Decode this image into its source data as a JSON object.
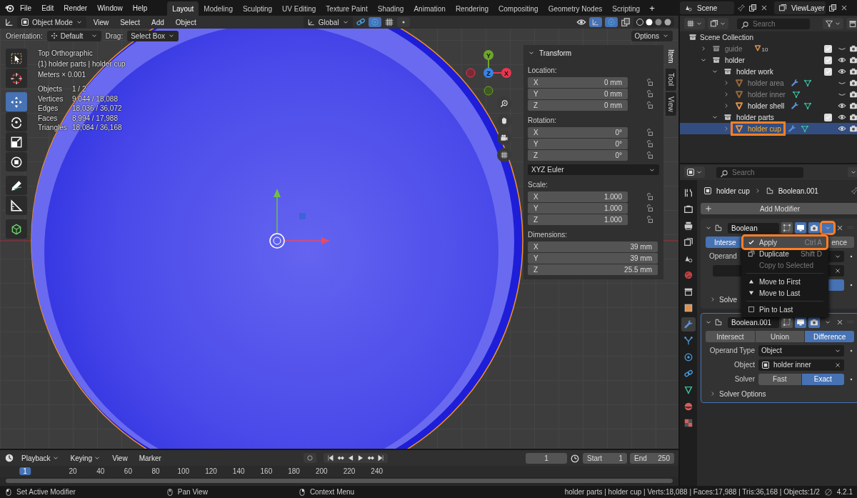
{
  "topbar": {
    "menus": [
      "File",
      "Edit",
      "Render",
      "Window",
      "Help"
    ],
    "workspaces": [
      {
        "label": "Layout",
        "selected": true
      },
      {
        "label": "Modeling",
        "selected": false
      },
      {
        "label": "Sculpting",
        "selected": false
      },
      {
        "label": "UV Editing",
        "selected": false
      },
      {
        "label": "Texture Paint",
        "selected": false
      },
      {
        "label": "Shading",
        "selected": false
      },
      {
        "label": "Animation",
        "selected": false
      },
      {
        "label": "Rendering",
        "selected": false
      },
      {
        "label": "Compositing",
        "selected": false
      },
      {
        "label": "Geometry Nodes",
        "selected": false
      },
      {
        "label": "Scripting",
        "selected": false
      }
    ],
    "add_workspace": "+",
    "scene": "Scene",
    "view_layer": "ViewLayer"
  },
  "viewport_header": {
    "mode": "Object Mode",
    "menus": [
      "View",
      "Select",
      "Add",
      "Object"
    ],
    "orientation": "Global"
  },
  "tool_settings": {
    "orientation_label": "Orientation:",
    "orientation": "Default",
    "drag_label": "Drag:",
    "drag": "Select Box",
    "options": "Options"
  },
  "viewport": {
    "tool_groups": [
      {
        "tools": [
          {
            "kind": "select",
            "selected": false
          },
          {
            "kind": "cursor",
            "selected": false
          }
        ]
      },
      {
        "tools": [
          {
            "kind": "move",
            "selected": true
          },
          {
            "kind": "rotate",
            "selected": false
          },
          {
            "kind": "scale",
            "selected": false
          },
          {
            "kind": "transform",
            "selected": false
          }
        ]
      },
      {
        "tools": [
          {
            "kind": "annotate",
            "selected": false
          },
          {
            "kind": "measure",
            "selected": false
          }
        ]
      },
      {
        "tools": [
          {
            "kind": "add_cube",
            "selected": false
          }
        ]
      }
    ],
    "overlay_lines": [
      "Top Orthographic",
      "(1) holder parts | holder cup",
      "Meters × 0.001"
    ],
    "stats": [
      {
        "label": "Objects",
        "value": "1 / 2"
      },
      {
        "label": "Vertices",
        "value": "9,044 / 18,088"
      },
      {
        "label": "Edges",
        "value": "18,036 / 36,072"
      },
      {
        "label": "Faces",
        "value": "8,994 / 17,988"
      },
      {
        "label": "Triangles",
        "value": "18,084 / 36,168"
      }
    ],
    "axes": [
      {
        "label": "Y",
        "color": "#6ea52c"
      },
      {
        "label": "Z",
        "color": "#3b83e0"
      },
      {
        "label": "X",
        "color": "#e5384f"
      }
    ]
  },
  "sidebar": {
    "title": "Transform",
    "groups": [
      {
        "label": "Location:",
        "lock": true,
        "rows": [
          {
            "axis": "X",
            "value": "0 mm"
          },
          {
            "axis": "Y",
            "value": "0 mm"
          },
          {
            "axis": "Z",
            "value": "0 mm"
          }
        ]
      },
      {
        "label": "Rotation:",
        "lock": true,
        "mode": "XYZ Euler",
        "rows": [
          {
            "axis": "X",
            "value": "0°"
          },
          {
            "axis": "Y",
            "value": "0°"
          },
          {
            "axis": "Z",
            "value": "0°"
          }
        ]
      },
      {
        "label": "Scale:",
        "lock": true,
        "rows": [
          {
            "axis": "X",
            "value": "1.000"
          },
          {
            "axis": "Y",
            "value": "1.000"
          },
          {
            "axis": "Z",
            "value": "1.000"
          }
        ]
      },
      {
        "label": "Dimensions:",
        "lock": false,
        "rows": [
          {
            "axis": "X",
            "value": "39 mm"
          },
          {
            "axis": "Y",
            "value": "39 mm"
          },
          {
            "axis": "Z",
            "value": "25.5 mm"
          }
        ]
      }
    ],
    "tabs": [
      {
        "label": "Item",
        "selected": true
      },
      {
        "label": "Tool",
        "selected": false
      },
      {
        "label": "View",
        "selected": false
      }
    ]
  },
  "outliner": {
    "search_placeholder": "Search",
    "root": "Scene Collection",
    "items": [
      {
        "name": "guide",
        "kind": "collection",
        "expanded": false,
        "checked": true,
        "visible": false,
        "selected": false,
        "highlighted": false,
        "badge": "10"
      },
      {
        "name": "holder",
        "kind": "collection",
        "expanded": true,
        "checked": true,
        "visible": true,
        "selected": false,
        "highlighted": false,
        "children": [
          {
            "name": "holder work",
            "kind": "collection",
            "expanded": true,
            "checked": true,
            "visible": true,
            "selected": false,
            "highlighted": false,
            "children": [
              {
                "name": "holder area",
                "kind": "object",
                "expanded": false,
                "visible": false,
                "modifiers": true,
                "selected": false,
                "highlighted": false
              },
              {
                "name": "holder inner",
                "kind": "object",
                "expanded": false,
                "visible": false,
                "modifiers": false,
                "selected": false,
                "highlighted": false
              },
              {
                "name": "holder shell",
                "kind": "object",
                "expanded": false,
                "visible": true,
                "modifiers": true,
                "selected": false,
                "highlighted": false
              }
            ]
          },
          {
            "name": "holder parts",
            "kind": "collection",
            "expanded": true,
            "checked": true,
            "visible": true,
            "selected": false,
            "highlighted": false,
            "children": [
              {
                "name": "holder cup",
                "kind": "object",
                "expanded": false,
                "visible": true,
                "modifiers": true,
                "selected": true,
                "highlighted": true
              }
            ]
          }
        ]
      }
    ]
  },
  "properties": {
    "search_placeholder": "Search",
    "tabs": [
      {
        "kind": "tool",
        "selected": false
      },
      {
        "kind": "render",
        "selected": false
      },
      {
        "kind": "output",
        "selected": false
      },
      {
        "kind": "view_layer",
        "selected": false
      },
      {
        "kind": "scene",
        "selected": false
      },
      {
        "kind": "world",
        "selected": false
      },
      {
        "kind": "collection",
        "selected": false
      },
      {
        "kind": "object",
        "selected": false
      },
      {
        "kind": "modifier",
        "selected": true
      },
      {
        "kind": "particles",
        "selected": false
      },
      {
        "kind": "physics",
        "selected": false
      },
      {
        "kind": "constraints",
        "selected": false
      },
      {
        "kind": "data",
        "selected": false
      },
      {
        "kind": "material",
        "selected": false
      },
      {
        "kind": "texture",
        "selected": false
      }
    ],
    "object": "holder cup",
    "modifier": "Boolean.001",
    "add_modifier": "Add Modifier",
    "modifiers": [
      {
        "name": "Boolean",
        "active": false,
        "menu_open": true,
        "dropdown_highlighted": true,
        "operations": [
          {
            "label": "Interse",
            "selected": true
          },
          {
            "label": "ence",
            "selected": false
          }
        ],
        "operand_label": "Operand",
        "solvers": [
          {
            "selected": true
          }
        ],
        "options_label": "Solve"
      },
      {
        "name": "Boolean.001",
        "active": true,
        "menu_open": false,
        "dropdown_highlighted": false,
        "operations": [
          {
            "label": "Intersect",
            "selected": false
          },
          {
            "label": "Union",
            "selected": false
          },
          {
            "label": "Difference",
            "selected": true
          }
        ],
        "operand_label": "Operand Type",
        "operand_value": "Object",
        "object_label": "Object",
        "object_value": "holder inner",
        "solver_label": "Solver",
        "solvers": [
          {
            "label": "Fast",
            "selected": false
          },
          {
            "label": "Exact",
            "selected": true
          }
        ],
        "options_label": "Solver Options"
      }
    ],
    "menu": [
      {
        "kind": "check",
        "label": "Apply",
        "shortcut": "Ctrl A",
        "selected": true,
        "highlighted": true,
        "disabled": false
      },
      {
        "kind": "duplicate",
        "label": "Duplicate",
        "shortcut": "Shift D",
        "selected": false,
        "highlighted": false,
        "disabled": false
      },
      {
        "kind": "plain",
        "label": "Copy to Selected",
        "selected": false,
        "highlighted": false,
        "disabled": true
      },
      {
        "kind": "separator"
      },
      {
        "kind": "up",
        "label": "Move to First",
        "selected": false,
        "highlighted": false,
        "disabled": false
      },
      {
        "kind": "down",
        "label": "Move to Last",
        "selected": false,
        "highlighted": false,
        "disabled": false
      },
      {
        "kind": "separator"
      },
      {
        "kind": "checkbox",
        "label": "Pin to Last",
        "selected": false,
        "highlighted": false,
        "disabled": false
      }
    ]
  },
  "timeline": {
    "menus": [
      "Playback",
      "Keying",
      "View",
      "Marker"
    ],
    "current_frame": "1",
    "start_label": "Start",
    "start": "1",
    "end_label": "End",
    "end": "250",
    "ruler": [
      {
        "label": "1",
        "selected": true
      },
      {
        "label": "20",
        "selected": false
      },
      {
        "label": "40",
        "selected": false
      },
      {
        "label": "60",
        "selected": false
      },
      {
        "label": "80",
        "selected": false
      },
      {
        "label": "100",
        "selected": false
      },
      {
        "label": "120",
        "selected": false
      },
      {
        "label": "140",
        "selected": false
      },
      {
        "label": "160",
        "selected": false
      },
      {
        "label": "180",
        "selected": false
      },
      {
        "label": "200",
        "selected": false
      },
      {
        "label": "220",
        "selected": false
      },
      {
        "label": "240",
        "selected": false
      }
    ]
  },
  "status_bar": {
    "hints": [
      {
        "kind": "left",
        "label": "Set Active Modifier"
      },
      {
        "kind": "middle",
        "label": "Pan View"
      },
      {
        "kind": "right",
        "label": "Context Menu"
      }
    ],
    "stats": "holder parts | holder cup | Verts:18,088 | Faces:17,988 | Tris:36,168 | Objects:1/2",
    "version": "4.2.1"
  }
}
